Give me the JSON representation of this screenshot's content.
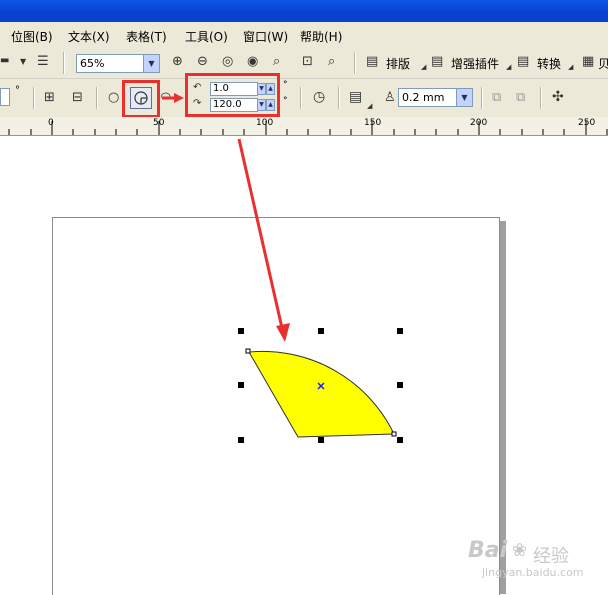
{
  "menu": [
    "位图(B)",
    "文本(X)",
    "表格(T)",
    "工具(O)",
    "窗口(W)",
    "帮助(H)"
  ],
  "toolbar1": {
    "zoom_value": "65%",
    "layout_label": "排版",
    "plugin_label": "增强插件",
    "convert_label": "转换",
    "cut_label": "贝"
  },
  "toolbar2": {
    "degree_unit": "°",
    "start_angle": "1.0",
    "end_angle": "120.0",
    "outline_width": "0.2 mm"
  },
  "ruler": {
    "ticks": [
      "0",
      "50",
      "100",
      "150",
      "200",
      "250"
    ]
  },
  "watermark": {
    "brand": "Bai",
    "brand2": "经验",
    "url": "jingyan.baidu.com"
  },
  "colors": {
    "shape_fill": "#ffff00",
    "highlight": "#e8312f",
    "toolbar_bg": "#ece9d8"
  }
}
